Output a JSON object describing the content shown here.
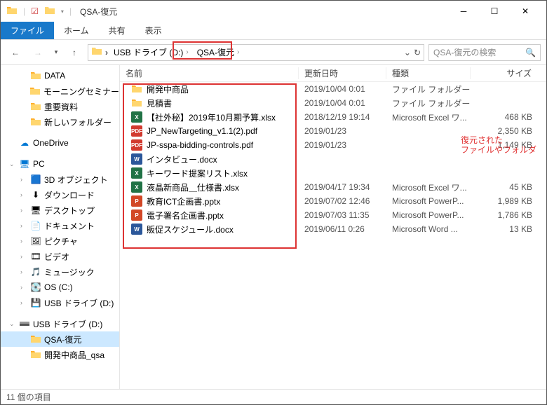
{
  "window": {
    "title": "QSA-復元"
  },
  "ribbon": {
    "tabs": [
      "ファイル",
      "ホーム",
      "共有",
      "表示"
    ]
  },
  "breadcrumb": {
    "drive": "USB ドライブ (D:)",
    "folder": "QSA-復元"
  },
  "search": {
    "placeholder": "QSA-復元の検索"
  },
  "sidebar": {
    "quick": [
      {
        "label": "DATA",
        "icon": "folder"
      },
      {
        "label": "モーニングセミナー",
        "icon": "folder"
      },
      {
        "label": "重要資料",
        "icon": "folder"
      },
      {
        "label": "新しいフォルダー",
        "icon": "folder"
      }
    ],
    "onedrive": {
      "label": "OneDrive"
    },
    "pc": {
      "label": "PC",
      "items": [
        {
          "label": "3D オブジェクト"
        },
        {
          "label": "ダウンロード"
        },
        {
          "label": "デスクトップ"
        },
        {
          "label": "ドキュメント"
        },
        {
          "label": "ピクチャ"
        },
        {
          "label": "ビデオ"
        },
        {
          "label": "ミュージック"
        },
        {
          "label": "OS (C:)"
        },
        {
          "label": "USB ドライブ (D:)"
        }
      ]
    },
    "usb": {
      "label": "USB ドライブ (D:)",
      "items": [
        {
          "label": "QSA-復元",
          "selected": true
        },
        {
          "label": "開発中商品_qsa"
        }
      ]
    }
  },
  "columns": {
    "name": "名前",
    "date": "更新日時",
    "type": "種類",
    "size": "サイズ"
  },
  "files": [
    {
      "name": "開発中商品",
      "date": "2019/10/04 0:01",
      "type": "ファイル フォルダー",
      "size": "",
      "icon": "folder"
    },
    {
      "name": "見積書",
      "date": "2019/10/04 0:01",
      "type": "ファイル フォルダー",
      "size": "",
      "icon": "folder"
    },
    {
      "name": "【社外秘】2019年10月期予算.xlsx",
      "date": "2018/12/19 19:14",
      "type": "Microsoft Excel ワ...",
      "size": "468 KB",
      "icon": "xlsx"
    },
    {
      "name": "JP_NewTargeting_v1.1(2).pdf",
      "date": "2019/01/23",
      "type": "",
      "size": "2,350 KB",
      "icon": "pdf"
    },
    {
      "name": "JP-sspa-bidding-controls.pdf",
      "date": "2019/01/23",
      "type": "",
      "size": "1,149 KB",
      "icon": "pdf"
    },
    {
      "name": "インタビュー.docx",
      "date": "",
      "type": "",
      "size": "",
      "icon": "docx"
    },
    {
      "name": "キーワード提案リスト.xlsx",
      "date": "",
      "type": "",
      "size": "",
      "icon": "xlsx"
    },
    {
      "name": "液晶新商品＿仕様書.xlsx",
      "date": "2019/04/17 19:34",
      "type": "Microsoft Excel ワ...",
      "size": "45 KB",
      "icon": "xlsx"
    },
    {
      "name": "教育ICT企画書.pptx",
      "date": "2019/07/02 12:46",
      "type": "Microsoft PowerP...",
      "size": "1,989 KB",
      "icon": "pptx"
    },
    {
      "name": "電子署名企画書.pptx",
      "date": "2019/07/03 11:35",
      "type": "Microsoft PowerP...",
      "size": "1,786 KB",
      "icon": "pptx"
    },
    {
      "name": "販促スケジュール.docx",
      "date": "2019/06/11 0:26",
      "type": "Microsoft Word ...",
      "size": "13 KB",
      "icon": "docx"
    }
  ],
  "status": {
    "text": "11 個の項目"
  },
  "annotation": {
    "line1": "復元された",
    "line2": "ファイルやフォルダ"
  },
  "icon_label": {
    "xlsx": "X",
    "pdf": "PDF",
    "docx": "W",
    "pptx": "P"
  }
}
